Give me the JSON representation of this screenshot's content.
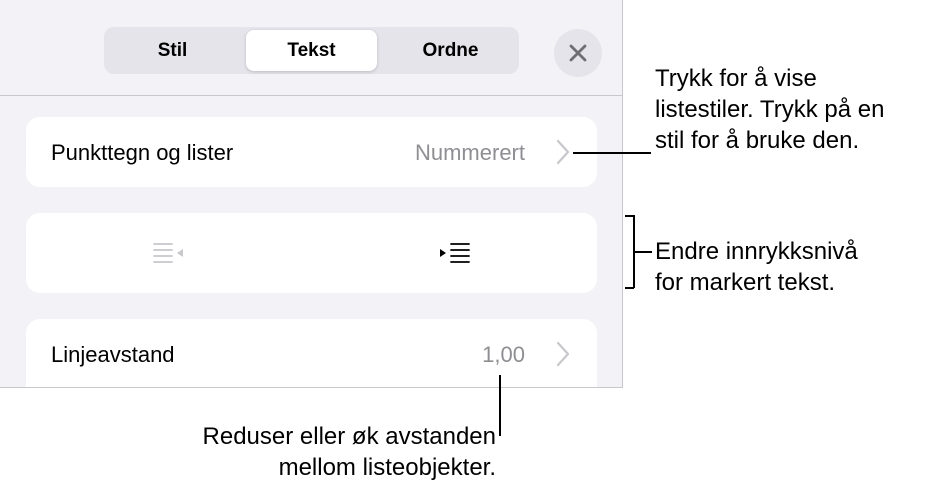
{
  "tabs": [
    {
      "label": "Stil"
    },
    {
      "label": "Tekst"
    },
    {
      "label": "Ordne"
    }
  ],
  "selected_tab": "Tekst",
  "close_icon": "close-icon",
  "rows": {
    "bullets": {
      "label": "Punkttegn og lister",
      "value": "Nummerert"
    },
    "indent": {
      "decrease_icon": "decrease-indent-icon",
      "increase_icon": "increase-indent-icon"
    },
    "line_spacing": {
      "label": "Linjeavstand",
      "value": "1,00"
    }
  },
  "callouts": {
    "list_styles": [
      "Trykk for å vise",
      "listestiler. Trykk på en",
      "stil for å bruke den."
    ],
    "indent": [
      "Endre innrykksnivå",
      "for markert tekst."
    ],
    "spacing": [
      "Reduser eller øk avstanden",
      "mellom listeobjekter."
    ]
  },
  "colors": {
    "panel_bg": "#f2f2f7",
    "card_bg": "#ffffff",
    "secondary_text": "#8e8e93",
    "disabled_icon": "#c7c7cc"
  }
}
